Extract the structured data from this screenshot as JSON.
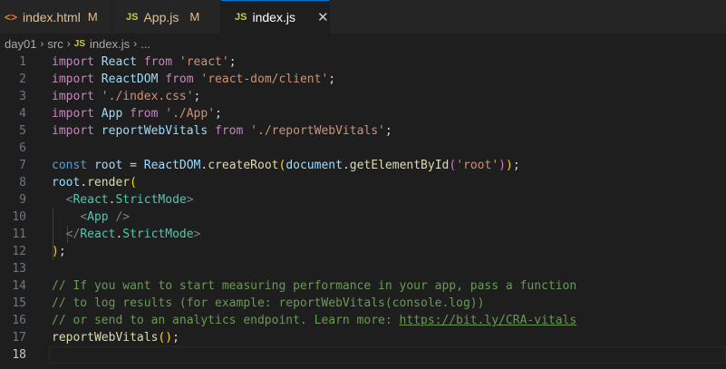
{
  "tabs": [
    {
      "label": "index.html",
      "icon": "html-file-icon",
      "status": "M"
    },
    {
      "label": "App.js",
      "icon": "js-file-icon",
      "status": "M"
    },
    {
      "label": "index.js",
      "icon": "js-file-icon",
      "close": "✕"
    }
  ],
  "breadcrumb": {
    "folder1": "day01",
    "folder2": "src",
    "file_icon": "JS",
    "file": "index.js",
    "ellipsis": "..."
  },
  "icons": {
    "html": "<>",
    "js": "JS",
    "chevron": "›"
  },
  "editor": {
    "current_line": 18,
    "lines": [
      [
        [
          "kw",
          "import "
        ],
        [
          "vr",
          "React "
        ],
        [
          "kw",
          "from "
        ],
        [
          "st",
          "'react'"
        ],
        [
          "pu",
          ";"
        ]
      ],
      [
        [
          "kw",
          "import "
        ],
        [
          "vr",
          "ReactDOM "
        ],
        [
          "kw",
          "from "
        ],
        [
          "st",
          "'react-dom/client'"
        ],
        [
          "pu",
          ";"
        ]
      ],
      [
        [
          "kw",
          "import "
        ],
        [
          "st",
          "'./index.css'"
        ],
        [
          "pu",
          ";"
        ]
      ],
      [
        [
          "kw",
          "import "
        ],
        [
          "vr",
          "App "
        ],
        [
          "kw",
          "from "
        ],
        [
          "st",
          "'./App'"
        ],
        [
          "pu",
          ";"
        ]
      ],
      [
        [
          "kw",
          "import "
        ],
        [
          "vr",
          "reportWebVitals "
        ],
        [
          "kw",
          "from "
        ],
        [
          "st",
          "'./reportWebVitals'"
        ],
        [
          "pu",
          ";"
        ]
      ],
      [],
      [
        [
          "bl",
          "const "
        ],
        [
          "vr",
          "root "
        ],
        [
          "pu",
          "= "
        ],
        [
          "vr",
          "ReactDOM"
        ],
        [
          "pu",
          "."
        ],
        [
          "fn",
          "createRoot"
        ],
        [
          "br1",
          "("
        ],
        [
          "vr",
          "document"
        ],
        [
          "pu",
          "."
        ],
        [
          "fn",
          "getElementById"
        ],
        [
          "br2",
          "("
        ],
        [
          "st",
          "'root'"
        ],
        [
          "br2",
          ")"
        ],
        [
          "br1",
          ")"
        ],
        [
          "pu",
          ";"
        ]
      ],
      [
        [
          "vr",
          "root"
        ],
        [
          "pu",
          "."
        ],
        [
          "fn",
          "render"
        ],
        [
          "br1",
          "("
        ]
      ],
      [
        [
          "pu",
          "  "
        ],
        [
          "tg",
          "<"
        ],
        [
          "ty",
          "React"
        ],
        [
          "pu",
          "."
        ],
        [
          "ty",
          "StrictMode"
        ],
        [
          "tg",
          ">"
        ]
      ],
      [
        [
          "pu",
          "    "
        ],
        [
          "tg",
          "<"
        ],
        [
          "ty",
          "App "
        ],
        [
          "tg",
          "/>"
        ]
      ],
      [
        [
          "pu",
          "  "
        ],
        [
          "tg",
          "</"
        ],
        [
          "ty",
          "React"
        ],
        [
          "pu",
          "."
        ],
        [
          "ty",
          "StrictMode"
        ],
        [
          "tg",
          ">"
        ]
      ],
      [
        [
          "br1",
          ")"
        ],
        [
          "pu",
          ";"
        ]
      ],
      [],
      [
        [
          "cm",
          "// If you want to start measuring performance in your app, pass a function"
        ]
      ],
      [
        [
          "cm",
          "// to log results (for example: reportWebVitals(console.log))"
        ]
      ],
      [
        [
          "cm",
          "// or send to an analytics endpoint. Learn more: "
        ],
        [
          "link",
          "https://bit.ly/CRA-vitals"
        ]
      ],
      [
        [
          "fn",
          "reportWebVitals"
        ],
        [
          "br1",
          "()"
        ],
        [
          "pu",
          ";"
        ]
      ],
      []
    ]
  }
}
